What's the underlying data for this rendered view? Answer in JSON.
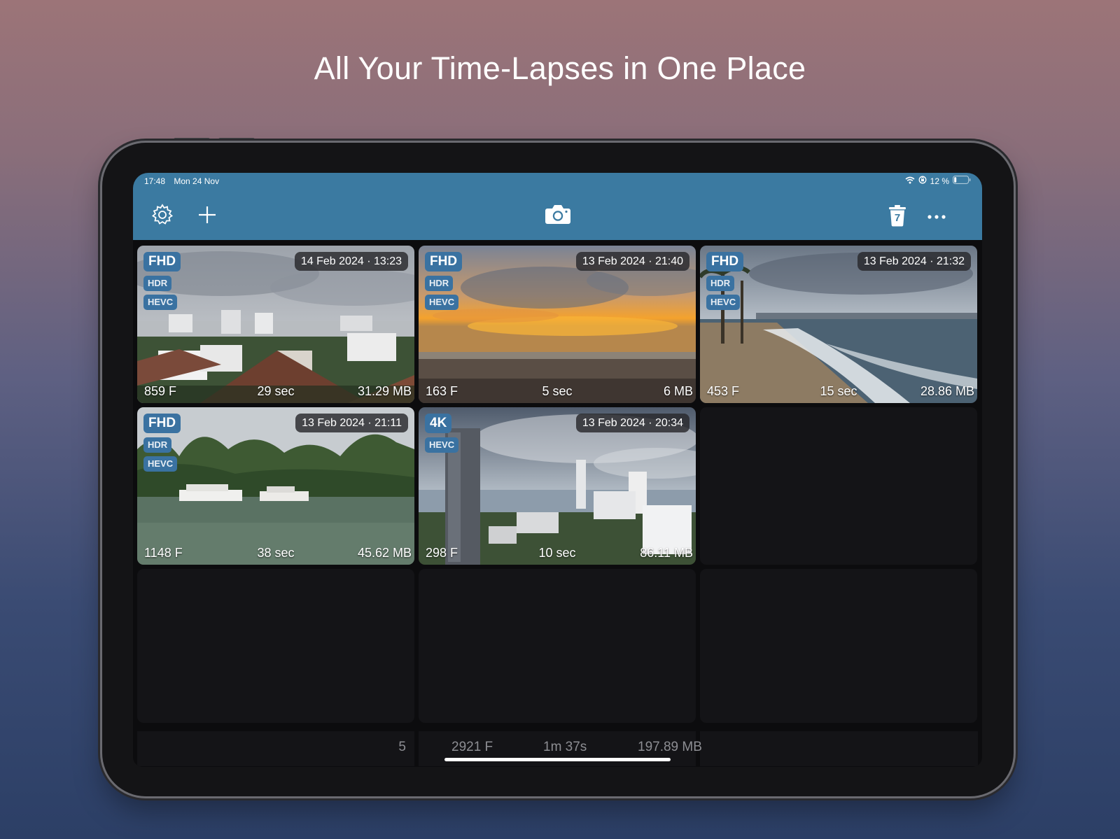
{
  "headline": "All Your Time-Lapses in One Place",
  "status_bar": {
    "time": "17:48",
    "date": "Mon 24 Nov",
    "battery": "12 %"
  },
  "toolbar": {
    "settings_icon": "gear-icon",
    "add_icon": "plus-icon",
    "camera_icon": "camera-icon",
    "trash_icon": "trash-icon",
    "trash_count": "7",
    "more_icon": "ellipsis-icon"
  },
  "timelapses": [
    {
      "resolution": "FHD",
      "tags": [
        "HDR",
        "HEVC"
      ],
      "date": "14 Feb 2024 · 13:23",
      "frames": "859 F",
      "duration": "29 sec",
      "size": "31.29 MB"
    },
    {
      "resolution": "FHD",
      "tags": [
        "HDR",
        "HEVC"
      ],
      "date": "13 Feb 2024 · 21:40",
      "frames": "163 F",
      "duration": "5 sec",
      "size": "6 MB"
    },
    {
      "resolution": "FHD",
      "tags": [
        "HDR",
        "HEVC"
      ],
      "date": "13 Feb 2024 · 21:32",
      "frames": "453 F",
      "duration": "15 sec",
      "size": "28.86 MB"
    },
    {
      "resolution": "FHD",
      "tags": [
        "HDR",
        "HEVC"
      ],
      "date": "13 Feb 2024 · 21:11",
      "frames": "1148 F",
      "duration": "38 sec",
      "size": "45.62 MB"
    },
    {
      "resolution": "4K",
      "tags": [
        "HEVC"
      ],
      "date": "13 Feb 2024 · 20:34",
      "frames": "298 F",
      "duration": "10 sec",
      "size": "86.11 MB"
    }
  ],
  "summary": {
    "count": "5",
    "frames": "2921 F",
    "duration": "1m 37s",
    "size": "197.89 MB"
  },
  "colors": {
    "toolbar": "#3b7aa1",
    "badge": "#3a72a1"
  }
}
